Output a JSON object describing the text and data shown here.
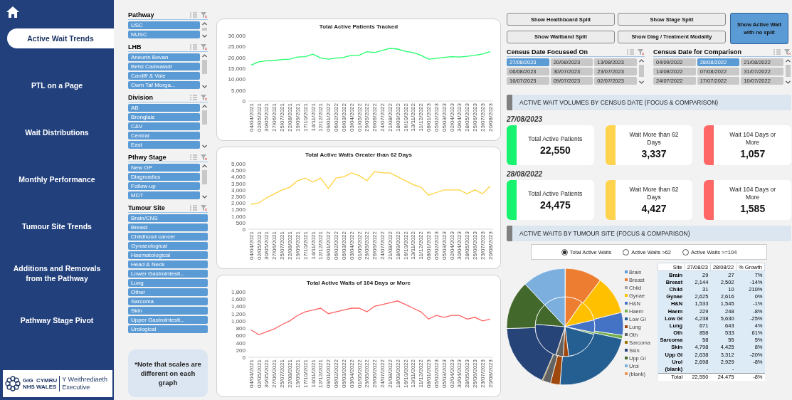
{
  "nav": {
    "items": [
      {
        "label": "Active Wait Trends",
        "selected": true
      },
      {
        "label": "PTL on a Page",
        "selected": false
      },
      {
        "label": "Wait Distributions",
        "selected": false
      },
      {
        "label": "Monthly Performance",
        "selected": false
      },
      {
        "label": "Tumour Site Trends",
        "selected": false
      },
      {
        "label": "Additions and Removals from the Pathway",
        "selected": false
      },
      {
        "label": "Pathway Stage Pivot",
        "selected": false
      }
    ],
    "logo": {
      "marks": [
        "GIG",
        "CYMRU",
        "NHS",
        "WALES"
      ],
      "org": [
        "Y Weithrediaeth",
        "Executive"
      ]
    }
  },
  "slicers": [
    {
      "title": "Pathway",
      "kind": "scrolling",
      "items": [
        {
          "label": "USC",
          "selected": true
        },
        {
          "label": "NUSC",
          "selected": true
        }
      ]
    },
    {
      "title": "LHB",
      "kind": "scrolling",
      "items": [
        {
          "label": "Aneurin Bevan",
          "selected": true
        },
        {
          "label": "Betsi Cadwaladr",
          "selected": true
        },
        {
          "label": "Cardiff & Vale",
          "selected": true
        },
        {
          "label": "Cwm Taf Morga...",
          "selected": true
        }
      ]
    },
    {
      "title": "Division",
      "kind": "scrolling",
      "items": [
        {
          "label": "AB",
          "selected": true
        },
        {
          "label": "Bronglais",
          "selected": true
        },
        {
          "label": "C&V",
          "selected": true
        },
        {
          "label": "Central",
          "selected": true
        },
        {
          "label": "East",
          "selected": true
        }
      ]
    },
    {
      "title": "Pthwy Stage",
      "kind": "scrolling",
      "items": [
        {
          "label": "New OP",
          "selected": true
        },
        {
          "label": "Diagnostics",
          "selected": true
        },
        {
          "label": "Follow-up",
          "selected": true
        },
        {
          "label": "MDT",
          "selected": true
        }
      ]
    },
    {
      "title": "Tumour Site",
      "kind": "plain",
      "items": [
        {
          "label": "Brain/CNS",
          "selected": true
        },
        {
          "label": "Breast",
          "selected": true
        },
        {
          "label": "Childhood cancer",
          "selected": true
        },
        {
          "label": "Gynaeological",
          "selected": true
        },
        {
          "label": "Haematological",
          "selected": true
        },
        {
          "label": "Head & Neck",
          "selected": true
        },
        {
          "label": "Lower Gastrointesti...",
          "selected": true
        },
        {
          "label": "Lung",
          "selected": true
        },
        {
          "label": "Other",
          "selected": true
        },
        {
          "label": "Sarcoma",
          "selected": true
        },
        {
          "label": "Skin",
          "selected": true
        },
        {
          "label": "Upper Gastrointesti...",
          "selected": true
        },
        {
          "label": "Urological",
          "selected": true
        }
      ]
    }
  ],
  "note": "*Note that scales are different on each graph",
  "charts": [
    {
      "chart_data": {
        "type": "line",
        "title": "Total Active Patients Tracked",
        "x": [
          "04/04/2021",
          "02/05/2021",
          "30/05/2021",
          "27/06/2021",
          "25/07/2021",
          "22/08/2021",
          "19/09/2021",
          "17/10/2021",
          "14/11/2021",
          "12/12/2021",
          "09/01/2022",
          "06/02/2022",
          "06/03/2022",
          "03/04/2022",
          "01/05/2022",
          "29/05/2022",
          "26/06/2022",
          "24/07/2022",
          "21/08/2022",
          "18/09/2022",
          "16/10/2022",
          "13/11/2022",
          "11/12/2022",
          "08/01/2023",
          "05/02/2023",
          "05/03/2023",
          "02/04/2023",
          "30/04/2023",
          "28/05/2023",
          "25/06/2023",
          "23/07/2023",
          "20/08/2023"
        ],
        "series": [
          {
            "color": "#1eff6a",
            "values": [
              16500,
              18000,
              18500,
              18600,
              19000,
              19200,
              20200,
              20300,
              21500,
              19800,
              19200,
              19700,
              20000,
              21000,
              21000,
              22600,
              22200,
              23200,
              24200,
              23800,
              22800,
              22200,
              21000,
              19200,
              19500,
              20000,
              20300,
              20200,
              20500,
              21000,
              21600,
              22700
            ]
          }
        ],
        "ylim": [
          0,
          30000
        ],
        "yticks": [
          0,
          {
            "value": 5000,
            "label": "5,000"
          },
          {
            "value": 10000,
            "label": "10,000"
          },
          {
            "value": 15000,
            "label": "15,000"
          },
          {
            "value": 20000,
            "label": "20,000"
          },
          {
            "value": 25000,
            "label": "25,000"
          },
          {
            "value": 30000,
            "label": "30,000"
          }
        ]
      }
    },
    {
      "chart_data": {
        "type": "line",
        "title": "Total Active Waits Greater than 62 Days",
        "x": [
          "04/04/2021",
          "02/05/2021",
          "30/05/2021",
          "27/06/2021",
          "25/07/2021",
          "22/08/2021",
          "19/09/2021",
          "17/10/2021",
          "14/11/2021",
          "12/12/2021",
          "09/01/2022",
          "06/02/2022",
          "06/03/2022",
          "03/04/2022",
          "01/05/2022",
          "29/05/2022",
          "26/06/2022",
          "24/07/2022",
          "21/08/2022",
          "18/09/2022",
          "16/10/2022",
          "13/11/2022",
          "11/12/2022",
          "08/01/2023",
          "05/02/2023",
          "05/03/2023",
          "02/04/2023",
          "30/04/2023",
          "28/05/2023",
          "25/06/2023",
          "23/07/2023",
          "20/08/2023"
        ],
        "series": [
          {
            "color": "#ffd23f",
            "values": [
              1900,
              2000,
              2400,
              2700,
              3000,
              3200,
              3700,
              3900,
              3600,
              3900,
              3100,
              3900,
              4000,
              4300,
              4100,
              3700,
              4400,
              4300,
              4300,
              4000,
              3700,
              3400,
              3200,
              2600,
              2800,
              3000,
              3000,
              3000,
              2700,
              3000,
              2700,
              3300
            ]
          }
        ],
        "ylim": [
          0,
          5000
        ],
        "yticks": [
          0,
          500,
          {
            "value": 1000,
            "label": "1,000"
          },
          {
            "value": 1500,
            "label": "1,500"
          },
          {
            "value": 2000,
            "label": "2,000"
          },
          {
            "value": 2500,
            "label": "2,500"
          },
          {
            "value": 3000,
            "label": "3,000"
          },
          {
            "value": 3500,
            "label": "3,500"
          },
          {
            "value": 4000,
            "label": "4,000"
          },
          {
            "value": 4500,
            "label": "4,500"
          },
          {
            "value": 5000,
            "label": "5,000"
          }
        ]
      }
    },
    {
      "chart_data": {
        "type": "line",
        "title": "Total Active Waits of 104 Days or More",
        "x": [
          "04/04/2021",
          "02/05/2021",
          "30/05/2021",
          "27/06/2021",
          "25/07/2021",
          "22/08/2021",
          "19/09/2021",
          "17/10/2021",
          "14/11/2021",
          "12/12/2021",
          "09/01/2022",
          "06/02/2022",
          "06/03/2022",
          "03/04/2022",
          "01/05/2022",
          "29/05/2022",
          "26/06/2022",
          "24/07/2022",
          "21/08/2022",
          "18/09/2022",
          "16/10/2022",
          "13/11/2022",
          "11/12/2022",
          "08/01/2023",
          "05/02/2023",
          "05/03/2023",
          "02/04/2023",
          "30/04/2023",
          "28/05/2023",
          "25/06/2023",
          "23/07/2023",
          "20/08/2023"
        ],
        "series": [
          {
            "color": "#ff6161",
            "values": [
              750,
              620,
              700,
              780,
              900,
              1000,
              1150,
              1250,
              1300,
              1350,
              1200,
              1250,
              1300,
              1350,
              1350,
              1250,
              1400,
              1450,
              1500,
              1550,
              1450,
              1350,
              1250,
              1050,
              1150,
              1100,
              1150,
              1150,
              1050,
              1100,
              1000,
              1050
            ]
          }
        ],
        "ylim": [
          0,
          1800
        ],
        "yticks": [
          0,
          200,
          400,
          600,
          800,
          {
            "value": 1000,
            "label": "1,000"
          },
          {
            "value": 1200,
            "label": "1,200"
          },
          {
            "value": 1400,
            "label": "1,400"
          },
          {
            "value": 1600,
            "label": "1,600"
          },
          {
            "value": 1800,
            "label": "1,800"
          }
        ]
      }
    }
  ],
  "split_buttons": [
    {
      "label": "Show Healthboard Split",
      "selected": false
    },
    {
      "label": "Show Stage Split",
      "selected": false
    },
    {
      "label": "Show Waitband Split",
      "selected": false
    },
    {
      "label": "Show Diag / Treatment Modality",
      "selected": false
    },
    {
      "label": "Show Active Wait with no split",
      "selected": true
    }
  ],
  "census_slicers": [
    {
      "title": "Census Date Focussed On",
      "items": [
        {
          "label": "27/08/2023",
          "selected": true
        },
        {
          "label": "20/08/2023",
          "selected": false
        },
        {
          "label": "13/08/2023",
          "selected": false
        },
        {
          "label": "06/08/2023",
          "selected": false
        },
        {
          "label": "30/07/2023",
          "selected": false
        },
        {
          "label": "23/07/2023",
          "selected": false
        },
        {
          "label": "16/07/2023",
          "selected": false
        },
        {
          "label": "09/07/2023",
          "selected": false
        },
        {
          "label": "02/07/2023",
          "selected": false
        }
      ]
    },
    {
      "title": "Census Date for Comparison",
      "items": [
        {
          "label": "04/09/2022",
          "selected": false
        },
        {
          "label": "28/08/2022",
          "selected": true
        },
        {
          "label": "21/08/2022",
          "selected": false
        },
        {
          "label": "14/08/2022",
          "selected": false
        },
        {
          "label": "07/08/2022",
          "selected": false
        },
        {
          "label": "31/07/2022",
          "selected": false
        },
        {
          "label": "24/07/2022",
          "selected": false
        },
        {
          "label": "17/07/2022",
          "selected": false
        },
        {
          "label": "10/07/2022",
          "selected": false
        }
      ]
    }
  ],
  "volumes": {
    "heading": "ACTIVE WAIT VOLUMES BY CENSUS DATE (FOCUS & COMPARISON)",
    "groups": [
      {
        "date": "27/08/2023",
        "cards": [
          {
            "label": "Total Active Patients",
            "value": "22,550",
            "color": "#17f26f"
          },
          {
            "label": "Wait More than 62 Days",
            "value": "3,337",
            "color": "#ffd34d"
          },
          {
            "label": "Wait 104 Days or More",
            "value": "1,057",
            "color": "#ff6666"
          }
        ]
      },
      {
        "date": "28/08/2022",
        "cards": [
          {
            "label": "Total Active Patients",
            "value": "24,475",
            "color": "#17f26f"
          },
          {
            "label": "Wait More than 62 Days",
            "value": "4,427",
            "color": "#ffd34d"
          },
          {
            "label": "Wait 104 Days or More",
            "value": "1,585",
            "color": "#ff6666"
          }
        ]
      }
    ]
  },
  "tumour": {
    "heading": "ACTIVE WAITS BY TUMOUR SITE (FOCUS & COMPARISON)",
    "options": [
      {
        "label": "Total Active Waits",
        "selected": true
      },
      {
        "label": "Active Waits >62",
        "selected": false
      },
      {
        "label": "Active Waits >=104",
        "selected": false
      }
    ],
    "legend": [
      {
        "label": "Brain",
        "color": "#5b9bd5"
      },
      {
        "label": "Breast",
        "color": "#ed7d31"
      },
      {
        "label": "Child",
        "color": "#a5a5a5"
      },
      {
        "label": "Gynae",
        "color": "#ffc000"
      },
      {
        "label": "H&N",
        "color": "#4472c4"
      },
      {
        "label": "Haem",
        "color": "#70ad47"
      },
      {
        "label": "Low GI",
        "color": "#255e91"
      },
      {
        "label": "Lung",
        "color": "#9e480e"
      },
      {
        "label": "Oth",
        "color": "#636363"
      },
      {
        "label": "Sarcoma",
        "color": "#997300"
      },
      {
        "label": "Skin",
        "color": "#264478"
      },
      {
        "label": "Upp GI",
        "color": "#43682b"
      },
      {
        "label": "Urol",
        "color": "#7cafdd"
      },
      {
        "label": "(blank)",
        "color": "#f1975a"
      }
    ],
    "table": {
      "columns": [
        "Site",
        "27/08/23",
        "28/08/22",
        "% Growth"
      ],
      "rows": [
        [
          "Brain",
          "29",
          "27",
          "7%"
        ],
        [
          "Breast",
          "2,144",
          "2,502",
          "-14%"
        ],
        [
          "Child",
          "31",
          "10",
          "210%"
        ],
        [
          "Gynae",
          "2,625",
          "2,616",
          "0%"
        ],
        [
          "H&N",
          "1,533",
          "1,545",
          "-1%"
        ],
        [
          "Haem",
          "229",
          "248",
          "-8%"
        ],
        [
          "Low GI",
          "4,238",
          "5,630",
          "-25%"
        ],
        [
          "Lung",
          "671",
          "643",
          "4%"
        ],
        [
          "Oth",
          "858",
          "533",
          "61%"
        ],
        [
          "Sarcoma",
          "58",
          "55",
          "5%"
        ],
        [
          "Skin",
          "4,798",
          "4,425",
          "8%"
        ],
        [
          "Upp GI",
          "2,638",
          "3,312",
          "-20%"
        ],
        [
          "Urol",
          "2,698",
          "2,929",
          "-8%"
        ],
        [
          "(blank)",
          "-",
          "-",
          ""
        ]
      ],
      "total": [
        "Total",
        "22,550",
        "24,475",
        "-8%"
      ]
    }
  }
}
